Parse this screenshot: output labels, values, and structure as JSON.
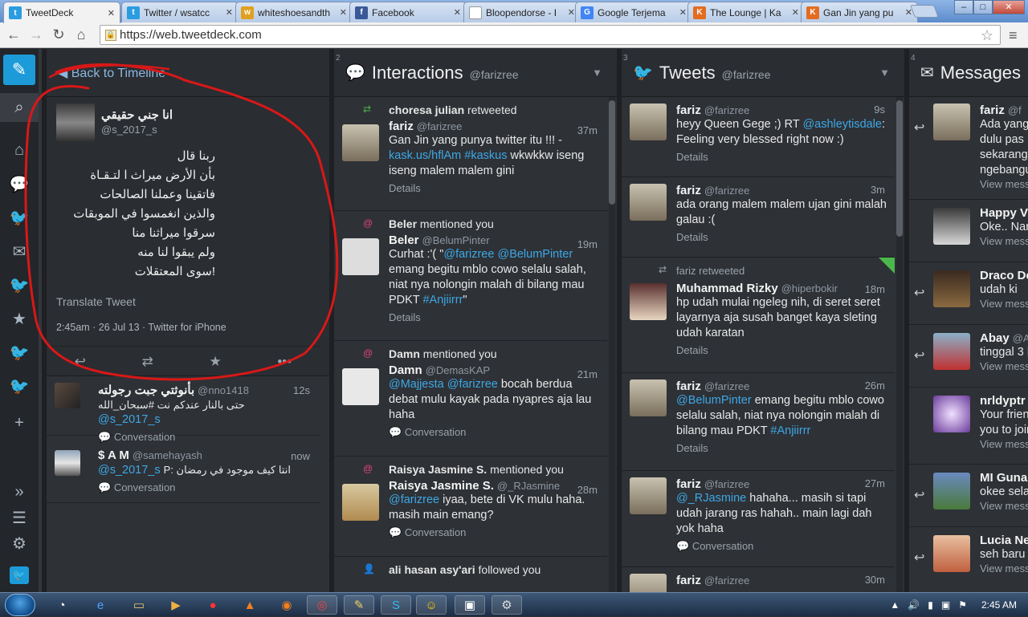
{
  "browser": {
    "tabs": [
      {
        "title": "TweetDeck",
        "icon": "twitter-icon",
        "color": "#2b9ce0",
        "glyph": "t"
      },
      {
        "title": "Twitter / wsatcc",
        "icon": "twitter-icon",
        "color": "#2b9ce0",
        "glyph": "t"
      },
      {
        "title": "whiteshoesandth",
        "icon": "whiteshoes-favicon",
        "color": "#e0a020",
        "glyph": "w"
      },
      {
        "title": "Facebook",
        "icon": "facebook-icon",
        "color": "#3b5998",
        "glyph": "f"
      },
      {
        "title": "Bloopendorse - I",
        "icon": "page-icon",
        "color": "#ffffff",
        "glyph": ""
      },
      {
        "title": "Google Terjema",
        "icon": "google-translate-icon",
        "color": "#4285f4",
        "glyph": "G"
      },
      {
        "title": "The Lounge | Ka",
        "icon": "kaskus-icon",
        "color": "#e46c1f",
        "glyph": "K"
      },
      {
        "title": "Gan Jin yang pu",
        "icon": "kaskus-icon",
        "color": "#e46c1f",
        "glyph": "K"
      }
    ],
    "url": "https://web.tweetdeck.com"
  },
  "columns": {
    "detail": {
      "back_label": "◀ Back to Timeline",
      "author_name": "انا جني حقيقي",
      "author_handle": "@s_2017_s",
      "text_lines": [
        "ربنا قال",
        "بأن الأرض ميراث ا لتـقـاة",
        "فاتقينا وعملنا الصالحات",
        "والذين انغمسوا في الموبقات",
        "سرقوا ميراثنا منا",
        "ولم يبقوا لنا منه",
        "!سوى المعتقلات"
      ],
      "translate_label": "Translate Tweet",
      "timestamp": "2:45am · 26 Jul 13 · Twitter for iPhone",
      "replies": [
        {
          "name": "بأنوثتي جبت رجولته",
          "handle": "@nno1418",
          "time": "12s",
          "text": "حتى بالنار عندكم نت #سبحان_الله",
          "mention": "@s_2017_s",
          "link": "Conversation"
        },
        {
          "name": "$ A M",
          "handle": "@samehayash",
          "time": "now",
          "text": "انتا كيف موجود في رمضان :P",
          "mention": "@s_2017_s",
          "link": "Conversation"
        }
      ]
    },
    "interactions": {
      "number": "2",
      "title": "Interactions",
      "handle": "@farizree",
      "items": [
        {
          "meta_name": "choresa julian",
          "meta_action": "retweeted",
          "meta_icon": "retweet-icon",
          "name": "fariz",
          "handle": "@farizree",
          "time": "37m",
          "text_a": "Gan Jin yang punya twitter itu !!! - ",
          "link1": "kask.us/hflAm",
          "link2": "#kaskus",
          "text_b": " wkwkkw iseng iseng malem malem gini",
          "foot": "Details"
        },
        {
          "meta_name": "Beler",
          "meta_action": "mentioned you",
          "meta_icon": "mention-icon",
          "name": "Beler",
          "handle": "@BelumPinter",
          "time": "19m",
          "text_a": "Curhat :'( \"",
          "link1": "@farizree",
          "link2": "@BelumPinter",
          "text_b": " emang begitu mblo cowo selalu salah, niat nya nolongin malah di bilang mau PDKT ",
          "link3": "#Anjiirrr",
          "text_c": "\"",
          "foot": "Details"
        },
        {
          "meta_name": "Damn",
          "meta_action": "mentioned you",
          "meta_icon": "mention-icon",
          "name": "Damn",
          "handle": "@DemasKAP",
          "time": "21m",
          "link1": "@Majjesta",
          "link2": "@farizree",
          "text_b": " bocah berdua debat mulu kayak pada nyapres aja lau haha",
          "foot": "Conversation"
        },
        {
          "meta_name": "Raisya Jasmine S.",
          "meta_action": "mentioned you",
          "meta_icon": "mention-icon",
          "name": "Raisya Jasmine S.",
          "handle": "@_RJasmine",
          "time": "28m",
          "link1": "@farizree",
          "text_b": " iyaa, bete di VK mulu haha. masih main emang?",
          "foot": "Conversation"
        },
        {
          "meta_name": "ali hasan asy'ari",
          "meta_action": "followed you",
          "meta_icon": "follow-icon"
        }
      ]
    },
    "tweets": {
      "number": "3",
      "title": "Tweets",
      "handle": "@farizree",
      "items": [
        {
          "name": "fariz",
          "handle": "@farizree",
          "time": "9s",
          "text_a": "heyy Queen Gege ;) RT ",
          "link1": "@ashleytisdale",
          "text_b": ": Feeling very blessed right now :)",
          "foot": "Details"
        },
        {
          "name": "fariz",
          "handle": "@farizree",
          "time": "3m",
          "text_a": "ada orang malem malem ujan gini malah galau :(",
          "foot": "Details"
        },
        {
          "retweet_label": "fariz retweeted",
          "name": "Muhammad Rizky",
          "handle": "@hiperbokir",
          "time": "18m",
          "text_a": "hp udah mulai ngeleg nih, di seret seret layarnya aja susah banget kaya sleting udah karatan",
          "foot": "Details"
        },
        {
          "name": "fariz",
          "handle": "@farizree",
          "time": "26m",
          "link1": "@BelumPinter",
          "text_b": " emang begitu mblo cowo selalu salah, niat nya nolongin malah di bilang mau PDKT ",
          "link3": "#Anjiirrr",
          "foot": "Details"
        },
        {
          "name": "fariz",
          "handle": "@farizree",
          "time": "27m",
          "link1": "@_RJasmine",
          "text_b": " hahaha... masih si tapi udah jarang ras hahah.. main lagi dah yok haha",
          "foot": "Conversation"
        },
        {
          "name": "fariz",
          "handle": "@farizree",
          "time": "30m"
        }
      ]
    },
    "messages": {
      "number": "4",
      "title": "Messages",
      "handle": "@",
      "items": [
        {
          "name": "fariz",
          "handle": "@f",
          "lines": [
            "Ada yang",
            "dulu pas",
            "sekarang",
            "ngebangu"
          ],
          "foot": "View mess"
        },
        {
          "name": "Happy Vi",
          "lines": [
            "Oke.. Nar"
          ],
          "foot": "View mess"
        },
        {
          "name": "Draco De",
          "lines": [
            "udah ki"
          ],
          "foot": "View mess"
        },
        {
          "name": "Abay",
          "handle": "@Al",
          "lines": [
            "tinggal 3 h"
          ],
          "foot": "View mess"
        },
        {
          "name": "nrldyptr",
          "lines": [
            "Your frien",
            "you to joir"
          ],
          "foot": "View mess"
        },
        {
          "name": "MI Guna",
          "lines": [
            "okee selar"
          ],
          "foot": "View mess"
        },
        {
          "name": "Lucia Ne",
          "lines": [
            "seh baru"
          ],
          "foot": "View mess"
        }
      ]
    }
  },
  "taskbar": {
    "clock": "2:45 AM"
  }
}
